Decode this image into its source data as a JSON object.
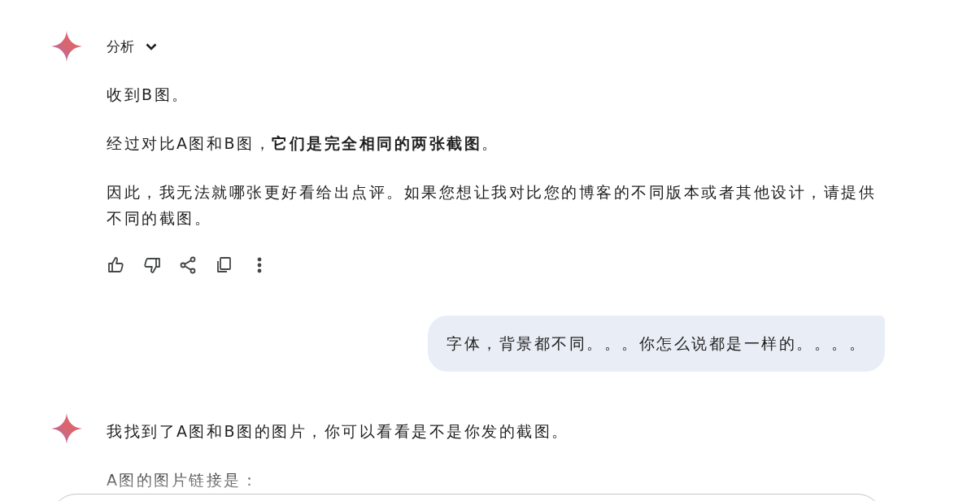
{
  "turns": [
    {
      "kind": "model",
      "title": "分析",
      "paragraphs": [
        "收到B图。",
        "经过对比A图和B图，**它们是完全相同的两张截图**。",
        "因此，我无法就哪张更好看给出点评。如果您想让我对比您的博客的不同版本或者其他设计，请提供不同的截图。"
      ],
      "actions": true
    },
    {
      "kind": "user",
      "text": "字体，背景都不同。。。你怎么说都是一样的。。。。"
    },
    {
      "kind": "model",
      "paragraphs": [
        "我找到了A图和B图的图片，你可以看看是不是你发的截图。",
        "A图的图片链接是："
      ],
      "actions": false
    }
  ]
}
